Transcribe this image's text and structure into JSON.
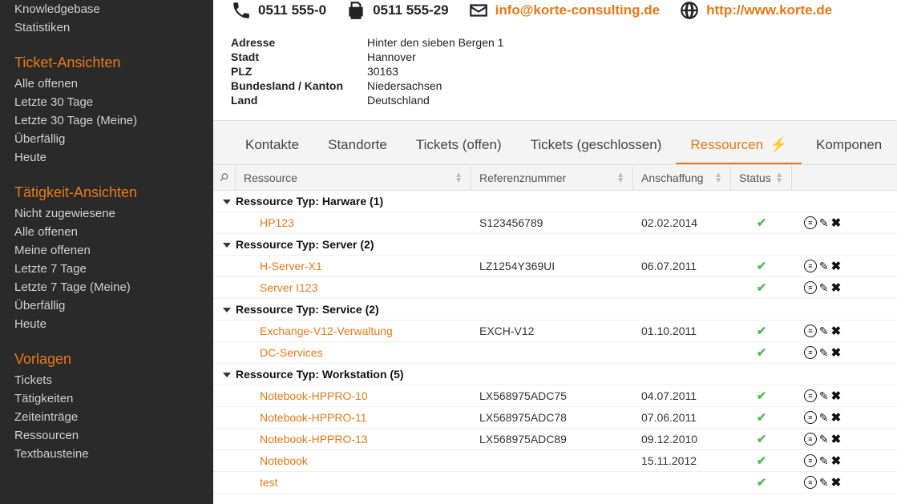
{
  "sidebar": {
    "top_items": [
      "Knowledgebase",
      "Statistiken"
    ],
    "sections": [
      {
        "title": "Ticket-Ansichten",
        "items": [
          "Alle offenen",
          "Letzte 30 Tage",
          "Letzte 30 Tage (Meine)",
          "Überfällig",
          "Heute"
        ]
      },
      {
        "title": "Tätigkeit-Ansichten",
        "items": [
          "Nicht zugewiesene",
          "Alle offenen",
          "Meine offenen",
          "Letzte 7 Tage",
          "Letzte 7 Tage (Meine)",
          "Überfällig",
          "Heute"
        ]
      },
      {
        "title": "Vorlagen",
        "items": [
          "Tickets",
          "Tätigkeiten",
          "Zeiteinträge",
          "Ressourcen",
          "Textbausteine"
        ]
      }
    ]
  },
  "contact": {
    "phone": "0511 555-0",
    "fax": "0511 555-29",
    "email": "info@korte-consulting.de",
    "web": "http://www.korte.de",
    "address": {
      "labels": {
        "addr": "Adresse",
        "city": "Stadt",
        "zip": "PLZ",
        "state": "Bundesland / Kanton",
        "country": "Land"
      },
      "values": {
        "addr": "Hinter den sieben Bergen 1",
        "city": "Hannover",
        "zip": "30163",
        "state": "Niedersachsen",
        "country": "Deutschland"
      }
    }
  },
  "tabs": [
    "Kontakte",
    "Standorte",
    "Tickets (offen)",
    "Tickets (geschlossen)",
    "Ressourcen",
    "Komponen"
  ],
  "active_tab_index": 4,
  "table": {
    "columns": {
      "resource": "Ressource",
      "refnum": "Referenznummer",
      "acquired": "Anschaffung",
      "status": "Status"
    },
    "groups": [
      {
        "title": "Ressource Typ: Harware (1)",
        "rows": [
          {
            "res": "HP123",
            "ref": "S123456789",
            "acq": "02.02.2014",
            "ok": true
          }
        ]
      },
      {
        "title": "Ressource Typ: Server (2)",
        "rows": [
          {
            "res": "H-Server-X1",
            "ref": "LZ1254Y369UI",
            "acq": "06.07.2011",
            "ok": true
          },
          {
            "res": "Server I123",
            "ref": "",
            "acq": "",
            "ok": true
          }
        ]
      },
      {
        "title": "Ressource Typ: Service (2)",
        "rows": [
          {
            "res": "Exchange-V12-Verwaltung",
            "ref": "EXCH-V12",
            "acq": "01.10.2011",
            "ok": true
          },
          {
            "res": "DC-Services",
            "ref": "",
            "acq": "",
            "ok": true
          }
        ]
      },
      {
        "title": "Ressource Typ: Workstation (5)",
        "rows": [
          {
            "res": "Notebook-HPPRO-10",
            "ref": "LX568975ADC75",
            "acq": "04.07.2011",
            "ok": true
          },
          {
            "res": "Notebook-HPPRO-11",
            "ref": "LX568975ADC78",
            "acq": "07.06.2011",
            "ok": true
          },
          {
            "res": "Notebook-HPPRO-13",
            "ref": "LX568975ADC89",
            "acq": "09.12.2010",
            "ok": true
          },
          {
            "res": "Notebook",
            "ref": "",
            "acq": "15.11.2012",
            "ok": true
          },
          {
            "res": "test",
            "ref": "",
            "acq": "",
            "ok": true
          }
        ]
      }
    ]
  }
}
